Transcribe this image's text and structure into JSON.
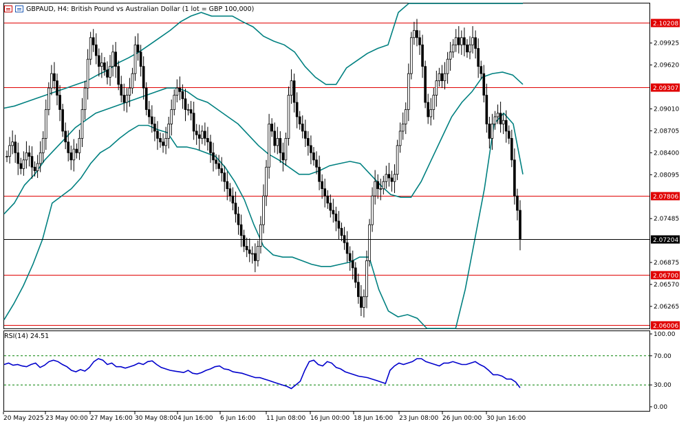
{
  "header": {
    "title": "GBPAUD, H4:  British Pound vs Australian Dollar (1 lot = GBP 100,000)"
  },
  "price_axis": {
    "ticks": [
      "2.09925",
      "2.09620",
      "2.09010",
      "2.08705",
      "2.08400",
      "2.08095",
      "2.07485",
      "2.06875",
      "2.06570",
      "2.06265"
    ]
  },
  "levels": [
    {
      "label": "2.10208",
      "value": 2.10208,
      "color": "#e00000"
    },
    {
      "label": "2.09307",
      "value": 2.09307,
      "color": "#e00000"
    },
    {
      "label": "2.07806",
      "value": 2.07806,
      "color": "#e00000"
    },
    {
      "label": "2.06700",
      "value": 2.067,
      "color": "#e00000"
    },
    {
      "label": "2.06006",
      "value": 2.06006,
      "color": "#e00000"
    }
  ],
  "current_price": {
    "label": "2.07204",
    "value": 2.07204
  },
  "time_axis": {
    "labels": [
      "20 May 2025",
      "23 May 00:00",
      "27 May 16:00",
      "30 May 08:00",
      "4 Jun 16:00",
      "6 Jun 16:00",
      "11 Jun 08:00",
      "16 Jun 00:00",
      "18 Jun 16:00",
      "23 Jun 08:00",
      "26 Jun 00:00",
      "30 Jun 16:00"
    ]
  },
  "rsi": {
    "title": "RSI(14) 24.51",
    "ticks": [
      "100.00",
      "70.00",
      "30.00",
      "0.00"
    ],
    "levels": [
      70,
      30
    ]
  },
  "colors": {
    "bands": "#008080",
    "rsi_line": "#0000cc",
    "level_line": "#e00000",
    "candle": "#000000"
  },
  "chart_data": {
    "type": "line",
    "title": "GBPAUD, H4:  British Pound vs Australian Dollar (1 lot = GBP 100,000)",
    "ylim": [
      2.06006,
      2.103
    ],
    "series": [
      {
        "name": "Close",
        "values": [
          2.0835,
          2.085,
          2.0855,
          2.084,
          2.0825,
          2.0818,
          2.083,
          2.084,
          2.0835,
          2.082,
          2.0815,
          2.0825,
          2.084,
          2.086,
          2.09,
          2.093,
          2.095,
          2.094,
          2.092,
          2.09,
          2.087,
          2.0855,
          2.084,
          2.083,
          2.0845,
          2.084,
          2.086,
          2.09,
          2.093,
          2.097,
          2.1,
          2.099,
          2.0975,
          2.096,
          2.0965,
          2.0955,
          2.0945,
          2.096,
          2.098,
          2.096,
          2.0935,
          2.092,
          2.091,
          2.092,
          2.093,
          2.095,
          2.099,
          2.098,
          2.096,
          2.093,
          2.09,
          2.089,
          2.088,
          2.087,
          2.086,
          2.0855,
          2.085,
          2.086,
          2.088,
          2.09,
          2.092,
          2.093,
          2.0925,
          2.0915,
          2.09,
          2.09,
          2.0895,
          2.087,
          2.0865,
          2.086,
          2.087,
          2.086,
          2.0855,
          2.084,
          2.083,
          2.0825,
          2.0818,
          2.0812,
          2.08,
          2.079,
          2.078,
          2.077,
          2.0755,
          2.074,
          2.0725,
          2.071,
          2.0705,
          2.07,
          2.07,
          2.069,
          2.071,
          2.074,
          2.078,
          2.082,
          2.088,
          2.087,
          2.085,
          2.086,
          2.084,
          2.083,
          2.086,
          2.092,
          2.094,
          2.091,
          2.089,
          2.088,
          2.087,
          2.086,
          2.085,
          2.084,
          2.083,
          2.082,
          2.08,
          2.079,
          2.078,
          2.077,
          2.076,
          2.0755,
          2.0745,
          2.0735,
          2.0725,
          2.0715,
          2.07,
          2.069,
          2.068,
          2.066,
          2.064,
          2.0625,
          2.064,
          2.069,
          2.074,
          2.078,
          2.08,
          2.079,
          2.079,
          2.08,
          2.081,
          2.0805,
          2.08,
          2.081,
          2.085,
          2.087,
          2.088,
          2.09,
          2.095,
          2.1,
          2.101,
          2.1,
          2.099,
          2.096,
          2.091,
          2.089,
          2.09,
          2.092,
          2.094,
          2.095,
          2.094,
          2.095,
          2.097,
          2.098,
          2.099,
          2.1,
          2.099,
          2.1,
          2.099,
          2.098,
          2.099,
          2.1,
          2.0985,
          2.096,
          2.095,
          2.092,
          2.088,
          2.086,
          2.088,
          2.089,
          2.0895,
          2.088,
          2.0885,
          2.087,
          2.086,
          2.083,
          2.078,
          2.076,
          2.07204
        ]
      },
      {
        "name": "Upper band",
        "values": [
          2.0902,
          2.0905,
          2.091,
          2.0915,
          2.092,
          2.0925,
          2.093,
          2.0935,
          2.094,
          2.0948,
          2.0955,
          2.0965,
          2.0972,
          2.098,
          2.099,
          2.1,
          2.101,
          2.1022,
          2.103,
          2.1035,
          2.103,
          2.103,
          2.103,
          2.1022,
          2.1015,
          2.1002,
          2.0995,
          2.099,
          2.098,
          2.096,
          2.0945,
          2.0935,
          2.0935,
          2.0958,
          2.0968,
          2.0978,
          2.0985,
          2.099,
          2.1035,
          2.1055,
          2.1075,
          2.1092,
          2.1105,
          2.1105,
          2.1098,
          2.112,
          2.114,
          2.115,
          2.1155,
          2.115,
          2.115
        ]
      },
      {
        "name": "Middle band",
        "values": [
          2.0755,
          2.077,
          2.0795,
          2.081,
          2.083,
          2.0845,
          2.086,
          2.0875,
          2.0885,
          2.0895,
          2.09,
          2.0905,
          2.091,
          2.0915,
          2.092,
          2.0925,
          2.093,
          2.093,
          2.0925,
          2.0915,
          2.091,
          2.09,
          2.089,
          2.088,
          2.0865,
          2.085,
          2.0838,
          2.083,
          2.082,
          2.081,
          2.081,
          2.0815,
          2.0822,
          2.0825,
          2.0828,
          2.0825,
          2.081,
          2.0795,
          2.0782,
          2.0778,
          2.0778,
          2.08,
          2.083,
          2.086,
          2.089,
          2.091,
          2.0925,
          2.0945,
          2.095,
          2.0952,
          2.0948,
          2.0935
        ]
      },
      {
        "name": "Lower band",
        "values": [
          2.0608,
          2.063,
          2.0655,
          2.0685,
          2.072,
          2.077,
          2.078,
          2.079,
          2.0805,
          2.0825,
          2.084,
          2.0848,
          2.086,
          2.087,
          2.0878,
          2.0878,
          2.0872,
          2.0868,
          2.0848,
          2.0848,
          2.0845,
          2.084,
          2.0835,
          2.082,
          2.08,
          2.0775,
          2.074,
          2.071,
          2.0698,
          2.0695,
          2.0695,
          2.069,
          2.0685,
          2.0682,
          2.0682,
          2.0685,
          2.0688,
          2.0695,
          2.0695,
          2.065,
          2.062,
          2.0612,
          2.0615,
          2.061,
          2.058,
          2.054,
          2.05,
          2.059,
          2.065,
          2.072,
          2.079,
          2.088,
          2.0895,
          2.088,
          2.081
        ]
      },
      {
        "name": "RSI",
        "values": [
          58,
          60,
          57,
          58,
          56,
          55,
          58,
          60,
          54,
          57,
          62,
          64,
          62,
          58,
          55,
          50,
          48,
          51,
          49,
          54,
          62,
          66,
          64,
          58,
          60,
          55,
          55,
          53,
          55,
          57,
          60,
          58,
          62,
          63,
          58,
          54,
          52,
          50,
          49,
          48,
          47,
          50,
          46,
          45,
          47,
          50,
          52,
          55,
          56,
          52,
          51,
          48,
          47,
          46,
          44,
          42,
          40,
          40,
          38,
          36,
          34,
          32,
          30,
          28,
          25,
          30,
          35,
          50,
          62,
          64,
          58,
          56,
          62,
          60,
          54,
          52,
          48,
          46,
          44,
          42,
          41,
          40,
          38,
          36,
          34,
          32,
          50,
          56,
          60,
          58,
          60,
          62,
          66,
          66,
          62,
          60,
          58,
          56,
          60,
          60,
          62,
          60,
          58,
          58,
          60,
          62,
          58,
          55,
          50,
          44,
          44,
          42,
          38,
          38,
          34,
          26
        ]
      }
    ]
  }
}
